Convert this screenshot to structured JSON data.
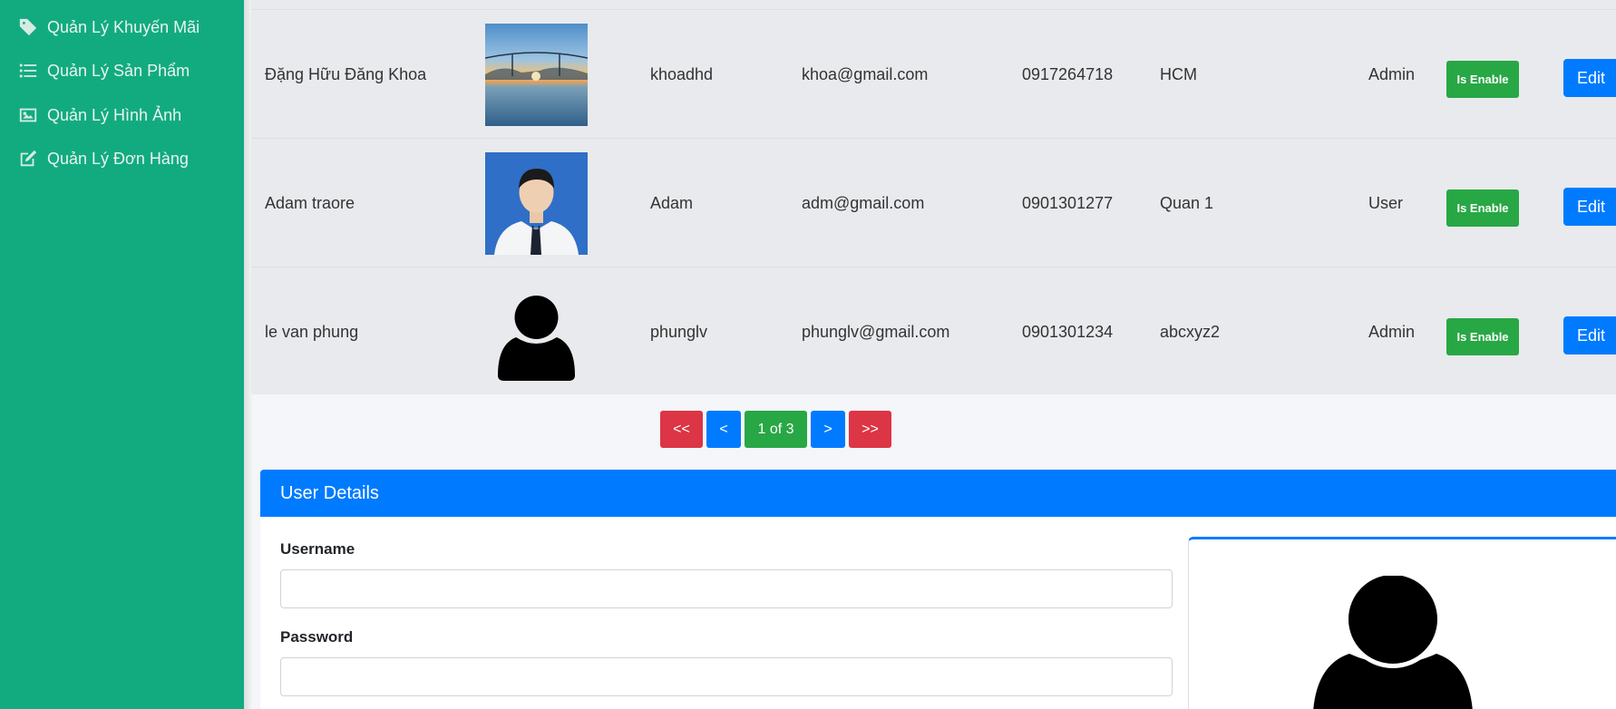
{
  "sidebar": {
    "items": [
      {
        "label": "Quản Lý Khuyến Mãi",
        "icon": "tag-icon"
      },
      {
        "label": "Quản Lý Sản Phẩm",
        "icon": "list-icon"
      },
      {
        "label": "Quản Lý Hình Ảnh",
        "icon": "image-icon"
      },
      {
        "label": "Quản Lý Đơn Hàng",
        "icon": "edit-icon"
      }
    ]
  },
  "users": [
    {
      "name": "Đặng Hữu Đăng Khoa",
      "image": "landscape-photo",
      "username": "khoadhd",
      "email": "khoa@gmail.com",
      "phone": "0917264718",
      "address": "HCM",
      "role": "Admin",
      "status": "Is Enable",
      "action": "Edit"
    },
    {
      "name": "Adam traore",
      "image": "portrait-photo",
      "username": "Adam",
      "email": "adm@gmail.com",
      "phone": "0901301277",
      "address": "Quan 1",
      "role": "User",
      "status": "Is Enable",
      "action": "Edit"
    },
    {
      "name": "le van phung",
      "image": "default-user-avatar",
      "username": "phunglv",
      "email": "phunglv@gmail.com",
      "phone": "0901301234",
      "address": "abcxyz2",
      "role": "Admin",
      "status": "Is Enable",
      "action": "Edit"
    }
  ],
  "pagination": {
    "first": "<<",
    "prev": "<",
    "current": "1 of 3",
    "next": ">",
    "last": ">>"
  },
  "details": {
    "title": "User Details",
    "username_label": "Username",
    "username_value": "",
    "password_label": "Password",
    "password_value": ""
  },
  "colors": {
    "sidebar": "#12ab80",
    "primary": "#007bff",
    "success": "#28a745",
    "danger": "#dc3545"
  }
}
